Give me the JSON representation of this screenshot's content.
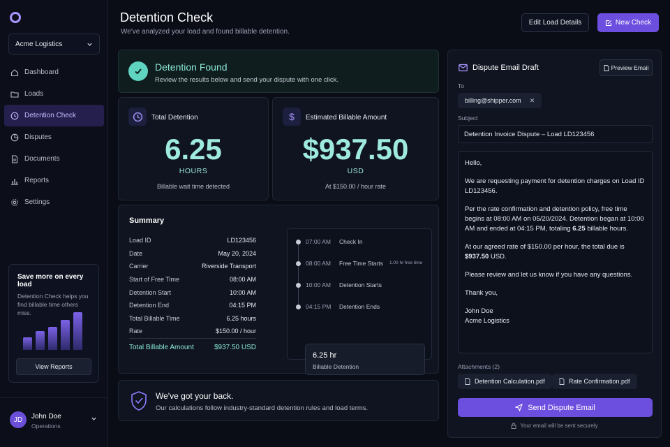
{
  "org": {
    "name": "Acme Logistics"
  },
  "nav": [
    {
      "label": "Dashboard",
      "icon": "dashboard-icon"
    },
    {
      "label": "Loads",
      "icon": "folder-icon"
    },
    {
      "label": "Detention Check",
      "icon": "clock-icon",
      "active": true
    },
    {
      "label": "Disputes",
      "icon": "dispute-icon"
    },
    {
      "label": "Documents",
      "icon": "document-icon"
    },
    {
      "label": "Reports",
      "icon": "chart-icon"
    },
    {
      "label": "Settings",
      "icon": "gear-icon"
    }
  ],
  "promo": {
    "title": "Save more on every load",
    "text": "Detention Check helps you find billable time others miss.",
    "bars": [
      0.33,
      0.5,
      0.62,
      0.8,
      1.0
    ],
    "button": "View Reports"
  },
  "user": {
    "initials": "JD",
    "name": "John Doe",
    "role": "Operations"
  },
  "header": {
    "title": "Detention Check",
    "subtitle": "We've analyzed your load and found billable detention.",
    "edit_label": "Edit Load Details",
    "new_label": "New Check"
  },
  "found": {
    "title": "Detention Found",
    "subtitle": "Review the results below and send your dispute with one click."
  },
  "metrics": {
    "total": {
      "title": "Total Detention",
      "value": "6.25",
      "unit": "HOURS",
      "note": "Billable wait time detected"
    },
    "billable": {
      "title": "Estimated Billable Amount",
      "value": "$937.50",
      "unit": "USD",
      "note": "At $150.00 / hour rate"
    }
  },
  "summary": {
    "title": "Summary",
    "rows": [
      {
        "label": "Load ID",
        "value": "LD123456"
      },
      {
        "label": "Date",
        "value": "May 20, 2024"
      },
      {
        "label": "Carrier",
        "value": "Riverside Transport"
      },
      {
        "label": "Start of Free Time",
        "value": "08:00 AM"
      },
      {
        "label": "Detention Start",
        "value": "10:00 AM"
      },
      {
        "label": "Detention End",
        "value": "04:15 PM"
      },
      {
        "label": "Total Billable Time",
        "value": "6.25 hours"
      },
      {
        "label": "Rate",
        "value": "$150.00 / hour"
      }
    ],
    "total_label": "Total Billable Amount",
    "total_value": "$937.50 USD"
  },
  "timeline": {
    "items": [
      {
        "time": "07:00 AM",
        "label": "Check In",
        "note": ""
      },
      {
        "time": "08:00 AM",
        "label": "Free Time Starts",
        "note": "1.00 hr free time"
      },
      {
        "time": "10:00 AM",
        "label": "Detention Starts",
        "note": ""
      },
      {
        "time": "04:15 PM",
        "label": "Detention Ends",
        "note": ""
      }
    ],
    "box_value": "6.25 hr",
    "box_label": "Billable Detention"
  },
  "back": {
    "title": "We've got your back.",
    "subtitle": "Our calculations follow industry-standard detention rules and load terms."
  },
  "email": {
    "title": "Dispute Email Draft",
    "preview_label": "Preview Email",
    "to_label": "To",
    "to_value": "billing@shipper.com",
    "subject_label": "Subject",
    "subject_value": "Detention Invoice Dispute – Load LD123456",
    "greeting": "Hello,",
    "p1": "We are requesting payment for detention charges on Load ID LD123456.",
    "p2a": "Per the rate confirmation and detention policy, free time begins at 08:00 AM on 05/20/2024. Detention began at 10:00 AM and ended at 04:15 PM, totaling ",
    "p2b": "6.25",
    "p2c": " billable hours.",
    "p3a": "At our agreed rate of $150.00 per hour, the total due is ",
    "p3b": "$937.50",
    "p3c": " USD.",
    "p4": "Please review and let us know if you have any questions.",
    "signoff": "Thank you,",
    "sig_name": "John Doe",
    "sig_company": "Acme Logistics",
    "attach_label": "Attachments (2)",
    "attachments": [
      "Detention Calculation.pdf",
      "Rate Confirmation.pdf"
    ],
    "send_label": "Send Dispute Email",
    "secure_text": "Your email will be sent securely"
  }
}
